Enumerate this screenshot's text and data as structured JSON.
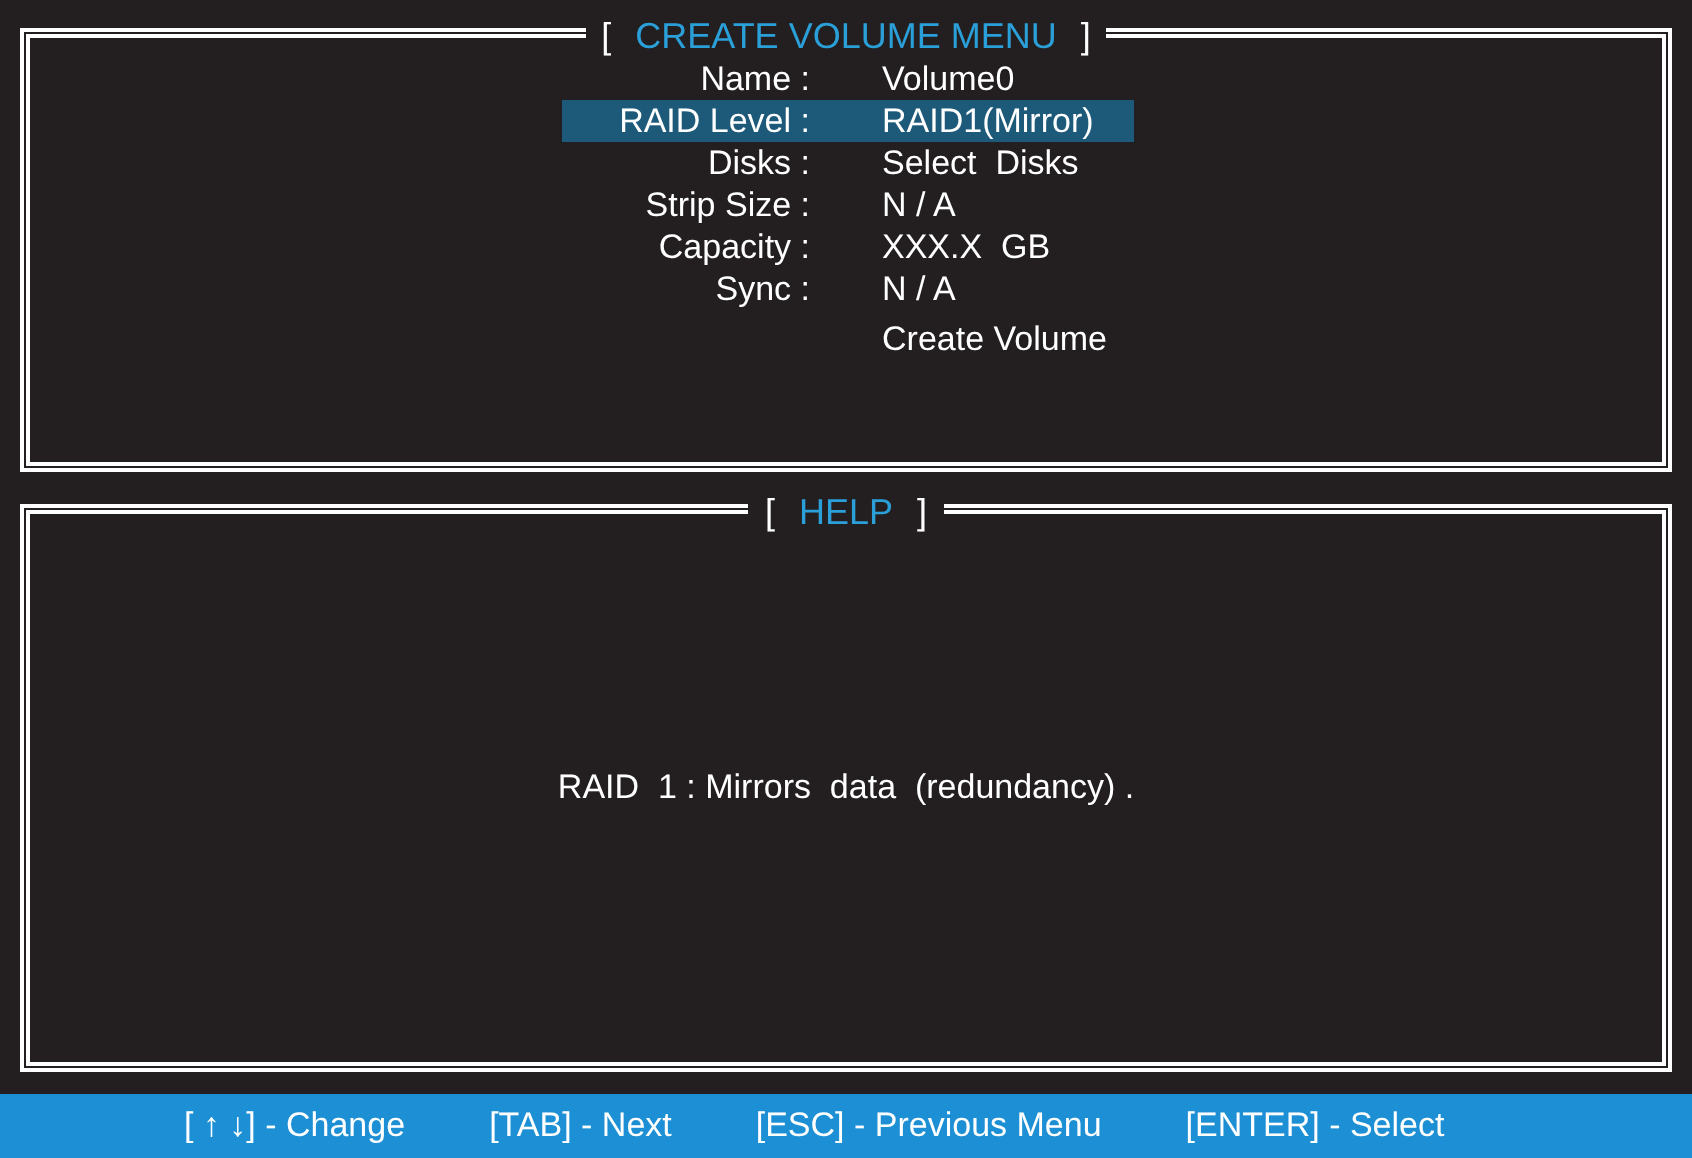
{
  "menu_panel": {
    "title": {
      "open": "[",
      "text": "CREATE VOLUME MENU",
      "close": "]"
    },
    "rows": [
      {
        "kind": "field",
        "label": "Name :",
        "value": "Volume0",
        "selected": false
      },
      {
        "kind": "field",
        "label": "RAID Level :",
        "value": "RAID1(Mirror)",
        "selected": true
      },
      {
        "kind": "field",
        "label": "Disks :",
        "value": "Select  Disks",
        "selected": false
      },
      {
        "kind": "field",
        "label": "Strip Size :",
        "value": "N / A",
        "selected": false
      },
      {
        "kind": "field",
        "label": "Capacity :",
        "value": "XXX.X  GB",
        "selected": false
      },
      {
        "kind": "field",
        "label": "Sync :",
        "value": "N / A",
        "selected": false
      },
      {
        "kind": "action",
        "value": "Create Volume",
        "selected": false
      }
    ]
  },
  "help_panel": {
    "title": {
      "open": "[",
      "text": "HELP",
      "close": "]"
    },
    "text": "RAID  1 : Mirrors  data  (redundancy) ."
  },
  "status_bar": [
    "[ ↑ ↓] - Change",
    "[TAB] - Next",
    "[ESC] - Previous Menu",
    "[ENTER] - Select"
  ]
}
